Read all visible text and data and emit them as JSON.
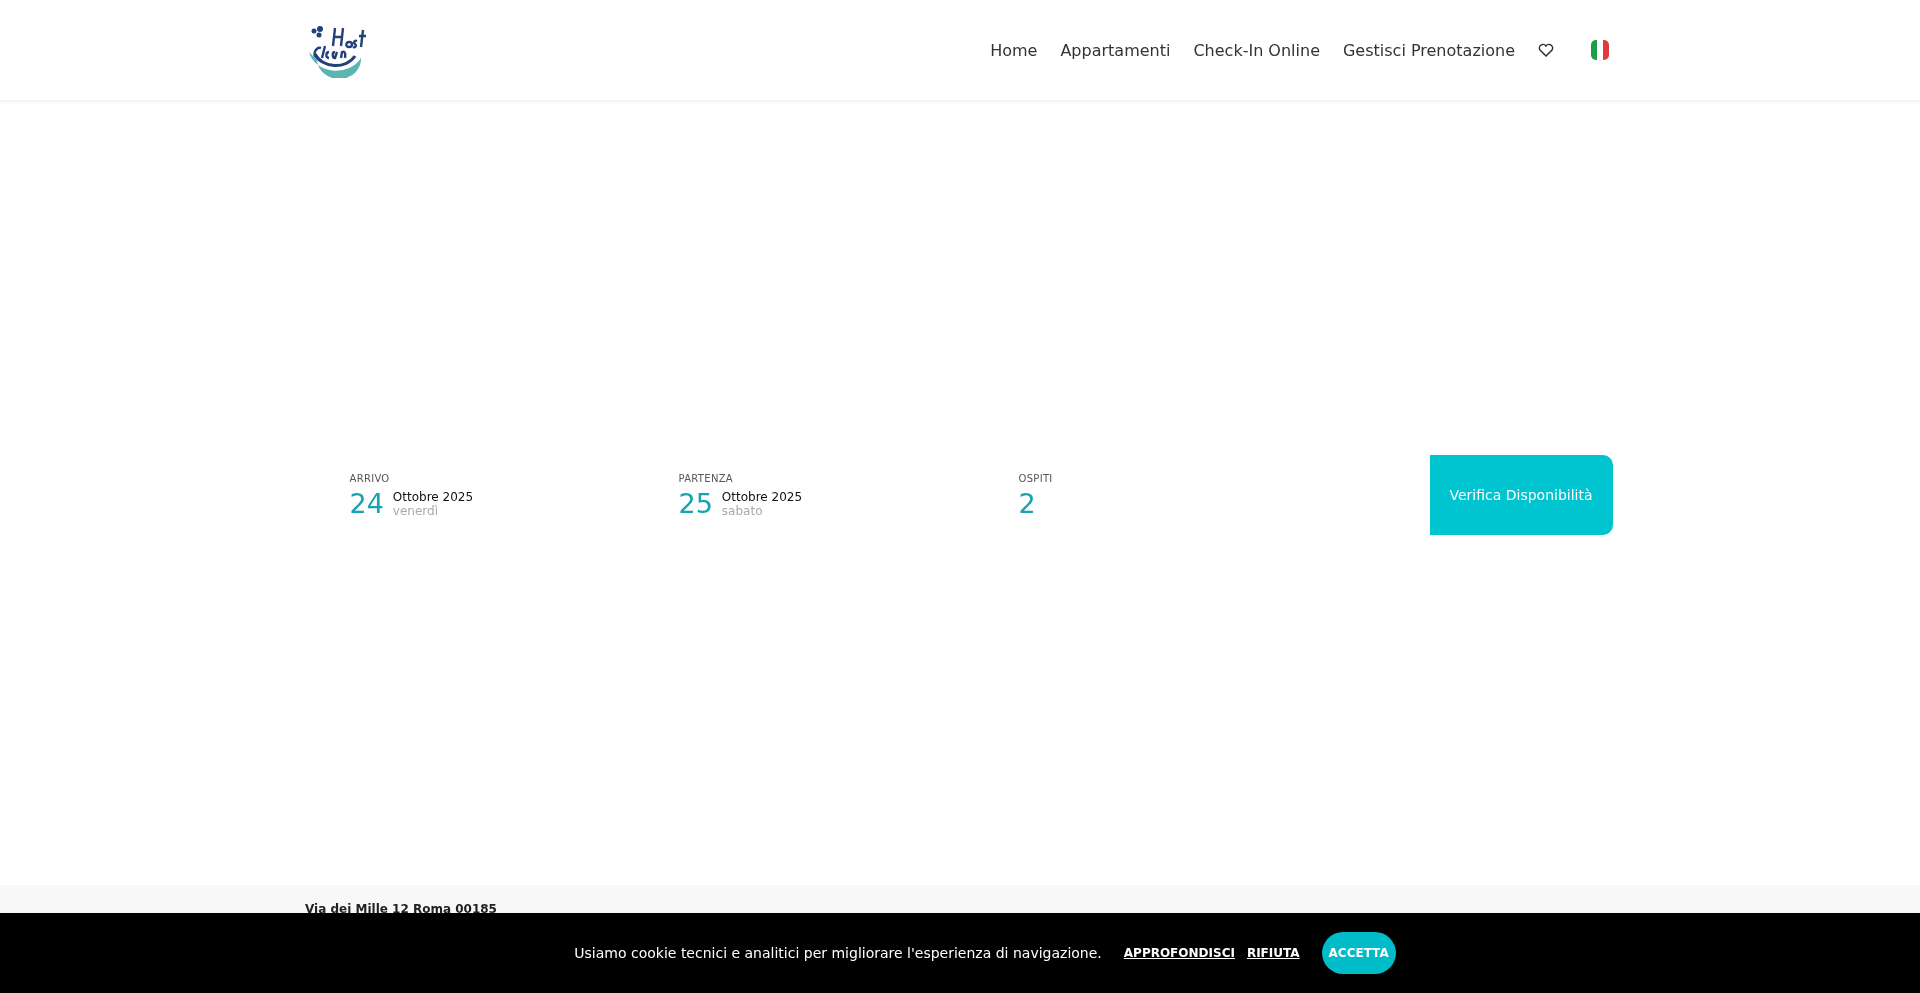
{
  "nav": {
    "items": [
      {
        "label": "Home"
      },
      {
        "label": "Appartamenti"
      },
      {
        "label": "Check-In Online"
      },
      {
        "label": "Gestisci Prenotazione"
      }
    ]
  },
  "booking": {
    "fields": [
      {
        "kind": "date",
        "label": "ARRIVO",
        "day": "24",
        "month": "Ottobre 2025",
        "weekday": "venerdì"
      },
      {
        "kind": "date",
        "label": "PARTENZA",
        "day": "25",
        "month": "Ottobre 2025",
        "weekday": "sabato"
      },
      {
        "kind": "count",
        "label": "OSPITI",
        "value": "2"
      }
    ],
    "button": "Verifica Disponibilità"
  },
  "footer": {
    "address": "Via dei Mille 12 Roma 00185"
  },
  "cookie_banner": {
    "message": "Usiamo cookie tecnici e analitici per migliorare l'esperienza di navigazione.",
    "links": [
      "APPROFONDISCI",
      "RIFIUTA"
    ],
    "accept": "ACCETTA"
  }
}
